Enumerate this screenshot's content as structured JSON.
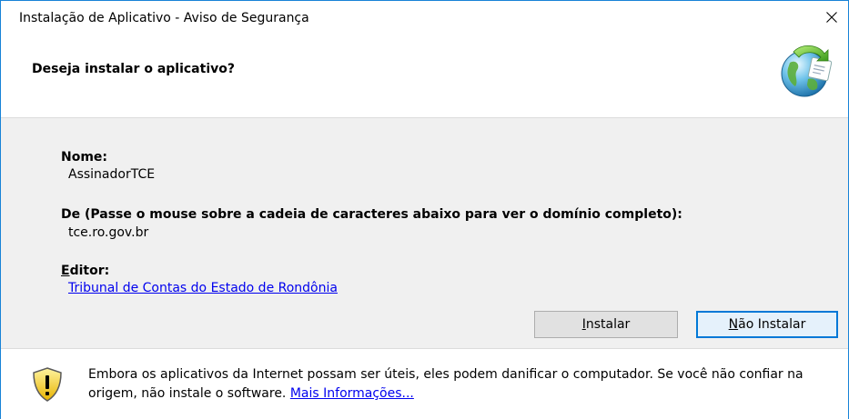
{
  "window": {
    "title": "Instalação de Aplicativo - Aviso de Segurança"
  },
  "header": {
    "question": "Deseja instalar o aplicativo?"
  },
  "details": {
    "name_label": "Nome:",
    "name_value": "AssinadorTCE",
    "from_label": "De (Passe o mouse sobre a cadeia de caracteres abaixo para ver o domínio completo):",
    "from_value": "tce.ro.gov.br",
    "publisher_label": "Editor:",
    "publisher_value": "Tribunal de Contas do Estado de Rondônia"
  },
  "buttons": {
    "install": "Instalar",
    "dont_install": "Não Instalar"
  },
  "footer": {
    "warning": "Embora os aplicativos da Internet possam ser úteis, eles podem danificar o computador. Se você não confiar na origem, não instale o software.",
    "more_info": "Mais Informações..."
  },
  "colors": {
    "window_border": "#1883d7",
    "content_bg": "#f0f0f0",
    "link": "#0000ee",
    "default_button_border": "#0078d7"
  },
  "icons": {
    "app": "globe-app-icon",
    "warning": "shield-warning-icon",
    "close": "close-icon"
  }
}
